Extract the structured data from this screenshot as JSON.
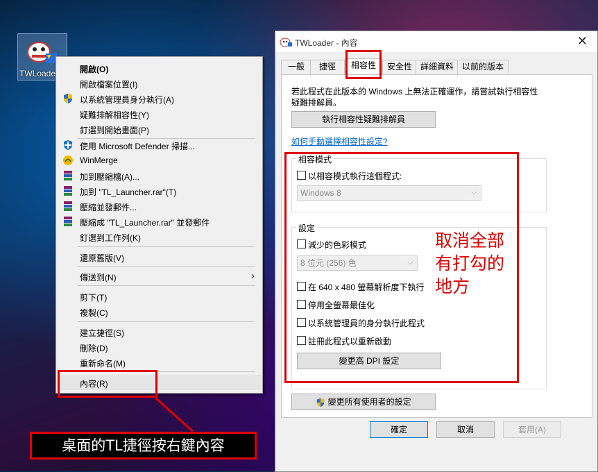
{
  "desktop": {
    "icon_label": "TWLoader"
  },
  "context_menu": {
    "items": [
      {
        "label": "開啟(O)",
        "bold": true,
        "icon": ""
      },
      {
        "label": "開啟檔案位置(I)",
        "icon": ""
      },
      {
        "label": "以系統管理員身分執行(A)",
        "icon": "uac-shield-icon"
      },
      {
        "label": "疑難排解相容性(Y)",
        "icon": ""
      },
      {
        "label": "釘選到開始畫面(P)",
        "icon": ""
      },
      {
        "label": "使用 Microsoft Defender 掃描...",
        "icon": "defender-icon"
      },
      {
        "label": "WinMerge",
        "icon": "winmerge-icon"
      },
      {
        "label": "加到壓縮檔(A)...",
        "icon": "winrar-icon"
      },
      {
        "label": "加到 \"TL_Launcher.rar\"(T)",
        "icon": "winrar-icon"
      },
      {
        "label": "壓縮並發郵件...",
        "icon": "winrar-icon"
      },
      {
        "label": "壓縮成 \"TL_Launcher.rar\" 並發郵件",
        "icon": "winrar-icon"
      },
      {
        "label": "釘選到工作列(K)",
        "icon": ""
      },
      {
        "label": "還原舊版(V)",
        "icon": ""
      },
      {
        "label": "傳送到(N)",
        "icon": "",
        "submenu": true
      },
      {
        "label": "剪下(T)",
        "icon": ""
      },
      {
        "label": "複製(C)",
        "icon": ""
      },
      {
        "label": "建立捷徑(S)",
        "icon": ""
      },
      {
        "label": "刪除(D)",
        "icon": ""
      },
      {
        "label": "重新命名(M)",
        "icon": ""
      },
      {
        "label": "內容(R)",
        "icon": ""
      }
    ]
  },
  "dialog": {
    "title": "TWLoader - 內容",
    "close_glyph": "✕",
    "tabs": [
      "一般",
      "捷徑",
      "相容性",
      "安全性",
      "詳細資料",
      "以前的版本"
    ],
    "active_tab": "相容性",
    "intro_line1": "若此程式在此版本的 Windows 上無法正確運作，請嘗試執行相容性",
    "intro_line2": "疑難排解員。",
    "troubleshooter_button": "執行相容性疑難排解員",
    "manual_link": "如何手動選擇相容性設定?",
    "compat_mode": {
      "legend": "相容模式",
      "checkbox_label": "以相容模式執行這個程式:",
      "checked": false,
      "os_select": "Windows 8"
    },
    "settings": {
      "legend": "設定",
      "reduced_color": {
        "label": "減少的色彩模式",
        "checked": false
      },
      "color_select": "8 位元 (256) 色",
      "run_640": {
        "label": "在 640 x 480 螢幕解析度下執行",
        "checked": false
      },
      "disable_fullscreen_opt": {
        "label": "停用全螢幕最佳化",
        "checked": false
      },
      "run_as_admin": {
        "label": "以系統管理員的身分執行此程式",
        "checked": false
      },
      "register_restart": {
        "label": "註冊此程式以重新啟動",
        "checked": false
      },
      "dpi_button": "變更高 DPI 設定"
    },
    "all_users_button": "變更所有使用者的設定",
    "ok_button": "確定",
    "cancel_button": "取消",
    "apply_button": "套用(A)"
  },
  "annotations": {
    "caption": "桌面的TL捷徑按右鍵內容",
    "note_line1": "取消全部",
    "note_line2": "有打勾的",
    "note_line3": "地方"
  }
}
